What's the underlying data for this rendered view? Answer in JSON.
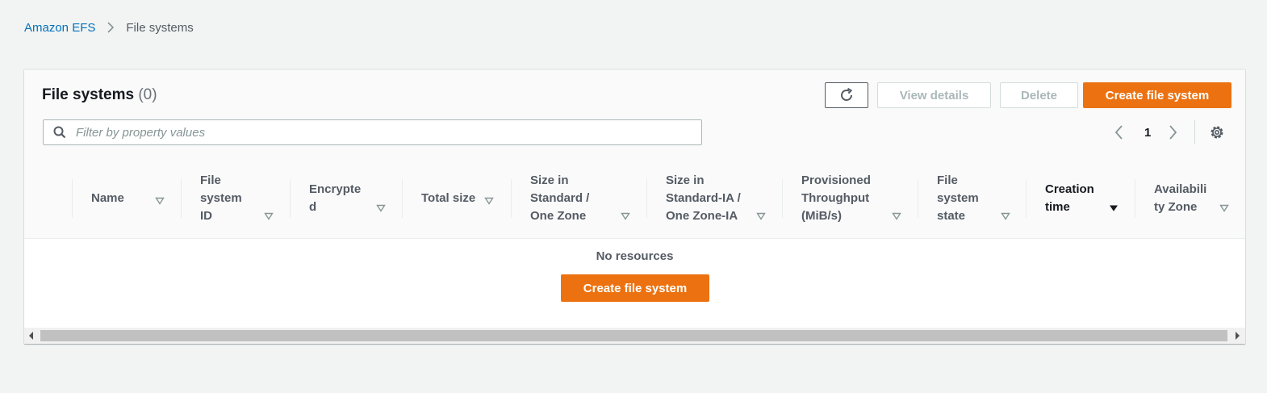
{
  "breadcrumb": {
    "root": "Amazon EFS",
    "current": "File systems"
  },
  "panel": {
    "title": "File systems",
    "count": "(0)"
  },
  "actions": {
    "view_details": "View details",
    "delete": "Delete",
    "create": "Create file system"
  },
  "filter": {
    "placeholder": "Filter by property values",
    "value": ""
  },
  "pagination": {
    "current_page": "1"
  },
  "columns": [
    {
      "label": "Name"
    },
    {
      "label": "File\nsystem\nID"
    },
    {
      "label": "Encrypte\nd"
    },
    {
      "label": "Total size"
    },
    {
      "label": "Size in\nStandard /\nOne Zone"
    },
    {
      "label": "Size in\nStandard-IA /\nOne Zone-IA"
    },
    {
      "label": "Provisioned\nThroughput\n(MiB/s)"
    },
    {
      "label": "File\nsystem\nstate"
    },
    {
      "label": "Creation\ntime",
      "sorted": "descending"
    },
    {
      "label": "Availabili\nty Zone"
    }
  ],
  "empty": {
    "message": "No resources",
    "create": "Create file system"
  },
  "colors": {
    "accent": "#ec7211",
    "link": "#0073bb"
  }
}
